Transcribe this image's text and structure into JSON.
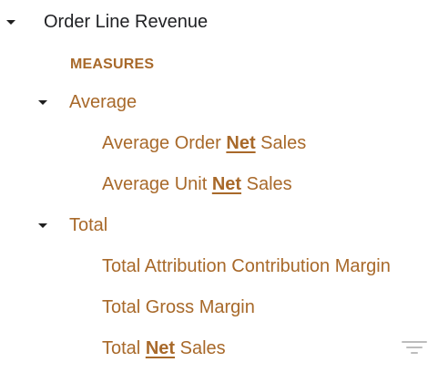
{
  "tree": {
    "root": {
      "label": "Order Line Revenue",
      "expanded": true
    },
    "section": {
      "label": "MEASURES"
    },
    "groups": [
      {
        "label": "Average",
        "expanded": true,
        "fields": [
          {
            "before": "Average Order ",
            "highlight": "Net",
            "after": " Sales"
          },
          {
            "before": "Average Unit ",
            "highlight": "Net",
            "after": " Sales"
          }
        ]
      },
      {
        "label": "Total",
        "expanded": true,
        "fields": [
          {
            "before": "Total Attribution Contribution Margin",
            "highlight": "",
            "after": ""
          },
          {
            "before": "Total Gross Margin",
            "highlight": "",
            "after": ""
          },
          {
            "before": "Total ",
            "highlight": "Net",
            "after": " Sales"
          }
        ]
      }
    ]
  },
  "icons": {
    "caret": "caret-down-icon",
    "filter": "filter-icon"
  },
  "colors": {
    "root_text": "#202124",
    "field_text": "#a8692a",
    "caret": "#1f1f1f",
    "filter_icon": "#bdbdbd"
  }
}
